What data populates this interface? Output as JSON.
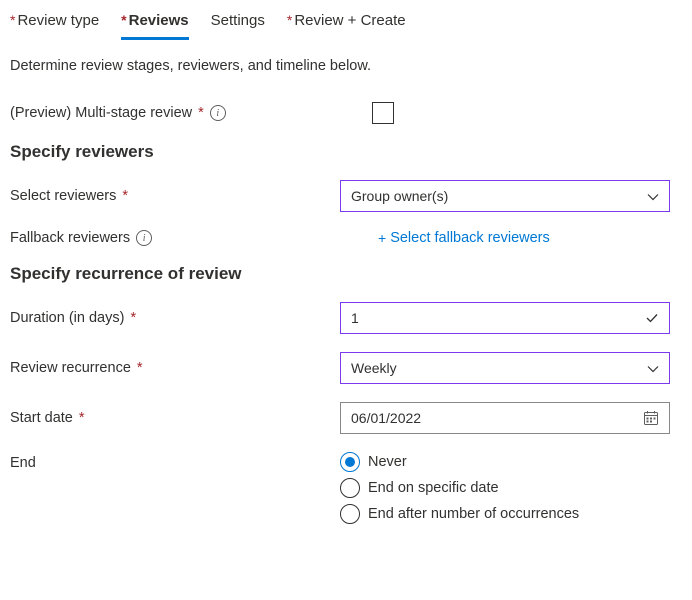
{
  "tabs": {
    "review_type": "Review type",
    "reviews": "Reviews",
    "settings": "Settings",
    "review_create": "Review + Create"
  },
  "subtitle": "Determine review stages, reviewers, and timeline below.",
  "multi_stage": {
    "label": "(Preview) Multi-stage review",
    "checked": false
  },
  "sections": {
    "specify_reviewers": "Specify reviewers",
    "specify_recurrence": "Specify recurrence of review"
  },
  "select_reviewers": {
    "label": "Select reviewers",
    "value": "Group owner(s)"
  },
  "fallback_reviewers": {
    "label": "Fallback reviewers",
    "link_text": "Select fallback reviewers"
  },
  "duration": {
    "label": "Duration (in days)",
    "value": "1"
  },
  "recurrence": {
    "label": "Review recurrence",
    "value": "Weekly"
  },
  "start_date": {
    "label": "Start date",
    "value": "06/01/2022"
  },
  "end": {
    "label": "End",
    "options": {
      "never": "Never",
      "specific": "End on specific date",
      "occurrences": "End after number of occurrences"
    },
    "selected": "never"
  },
  "chart_data": null
}
